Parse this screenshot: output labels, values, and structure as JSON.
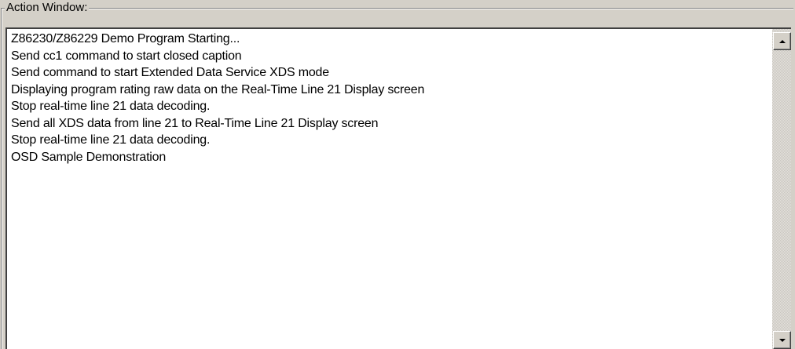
{
  "group": {
    "title": "Action Window:"
  },
  "log": {
    "lines": [
      "Z86230/Z86229 Demo Program Starting...",
      "Send cc1 command to start closed caption",
      "Send command to start Extended Data Service XDS mode",
      "Displaying program rating raw data on the Real-Time Line 21 Display screen",
      "Stop real-time line 21 data decoding.",
      "Send all XDS data from line 21 to Real-Time Line 21 Display screen",
      "Stop real-time line 21 data decoding.",
      "OSD Sample Demonstration"
    ]
  },
  "scrollbar": {
    "up_icon": "arrow-up-icon",
    "down_icon": "arrow-down-icon"
  }
}
